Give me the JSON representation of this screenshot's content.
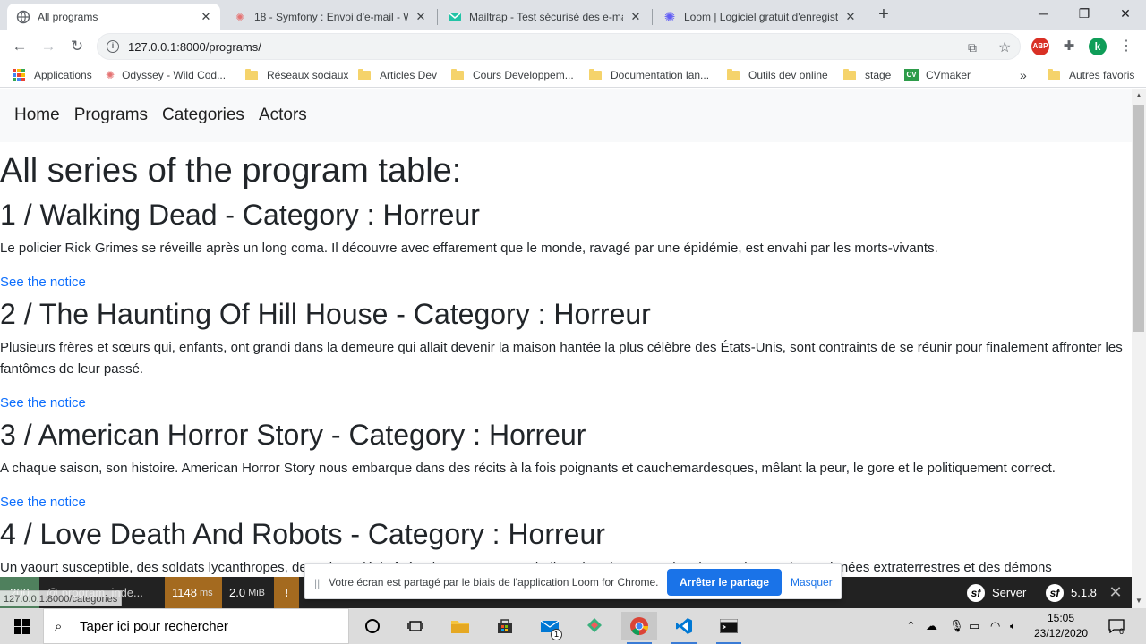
{
  "browser": {
    "tabs": [
      {
        "title": "All programs",
        "icon": "globe-icon",
        "active": true
      },
      {
        "title": "18 - Symfony : Envoi d'e-mail - W",
        "icon": "wild-code-icon",
        "active": false
      },
      {
        "title": "Mailtrap - Test sécurisé des e-ma",
        "icon": "mailtrap-icon",
        "active": false
      },
      {
        "title": "Loom | Logiciel gratuit d'enregist",
        "icon": "loom-icon",
        "active": false
      }
    ],
    "url": "127.0.0.1:8000/programs/",
    "profile_initial": "k",
    "adblock_label": "ABP"
  },
  "bookmarks": [
    {
      "label": "Applications",
      "icon": "apps-grid-icon"
    },
    {
      "label": "Odyssey - Wild Cod...",
      "icon": "wild-code-icon"
    },
    {
      "label": "Réseaux sociaux",
      "icon": "folder-icon"
    },
    {
      "label": "Articles Dev",
      "icon": "folder-icon"
    },
    {
      "label": "Cours Developpem...",
      "icon": "folder-icon"
    },
    {
      "label": "Documentation lan...",
      "icon": "folder-icon"
    },
    {
      "label": "Outils dev online",
      "icon": "folder-icon"
    },
    {
      "label": "stage",
      "icon": "folder-icon"
    },
    {
      "label": "CVmaker",
      "icon": "cv-icon"
    }
  ],
  "bookmarks_overflow": "»",
  "bookmarks_other": "Autres favoris",
  "cv_badge": "CV",
  "site_nav": [
    "Home",
    "Programs",
    "Categories",
    "Actors"
  ],
  "page_title": "All series of the program table:",
  "programs": [
    {
      "heading": "1 / Walking Dead - Category : Horreur",
      "summary": "Le policier Rick Grimes se réveille après un long coma. Il découvre avec effarement que le monde, ravagé par une épidémie, est envahi par les morts-vivants.",
      "link": "See the notice"
    },
    {
      "heading": "2 / The Haunting Of Hill House - Category : Horreur",
      "summary": "Plusieurs frères et sœurs qui, enfants, ont grandi dans la demeure qui allait devenir la maison hantée la plus célèbre des États-Unis, sont contraints de se réunir pour finalement affronter les fantômes de leur passé.",
      "link": "See the notice"
    },
    {
      "heading": "3 / American Horror Story - Category : Horreur",
      "summary": "A chaque saison, son histoire. American Horror Story nous embarque dans des récits à la fois poignants et cauchemardesques, mêlant la peur, le gore et le politiquement correct.",
      "link": "See the notice"
    },
    {
      "heading": "4 / Love Death And Robots - Category : Horreur",
      "summary": "Un yaourt susceptible, des soldats lycanthropes, des robots déchaînés, des monstres-poubelles, des chasseurs de primes cyborgs, des araignées extraterrestres et des démons",
      "link": ""
    }
  ],
  "status_link": "127.0.0.1:8000/categories",
  "debug_bar": {
    "status_code": "200",
    "route": "@ program_inde...",
    "time_value": "1148",
    "time_unit": "ms",
    "memory_value": "2.0",
    "memory_unit": "MiB",
    "warning": "!",
    "server_label": "Server",
    "version": "5.1.8",
    "close": "✕",
    "status_color": "#4f805d",
    "warn_color": "#a46a1f"
  },
  "loom_banner": {
    "message": "Votre écran est partagé par le biais de l'application Loom for Chrome.",
    "stop_button": "Arrêter le partage",
    "hide_button": "Masquer"
  },
  "taskbar": {
    "search_placeholder": "Taper ici pour rechercher",
    "time": "15:05",
    "date": "23/12/2020",
    "mail_badge": "1",
    "notification_badge": "6"
  },
  "colors": {
    "link": "#0d6efd",
    "loom_blue": "#1a73e8"
  }
}
